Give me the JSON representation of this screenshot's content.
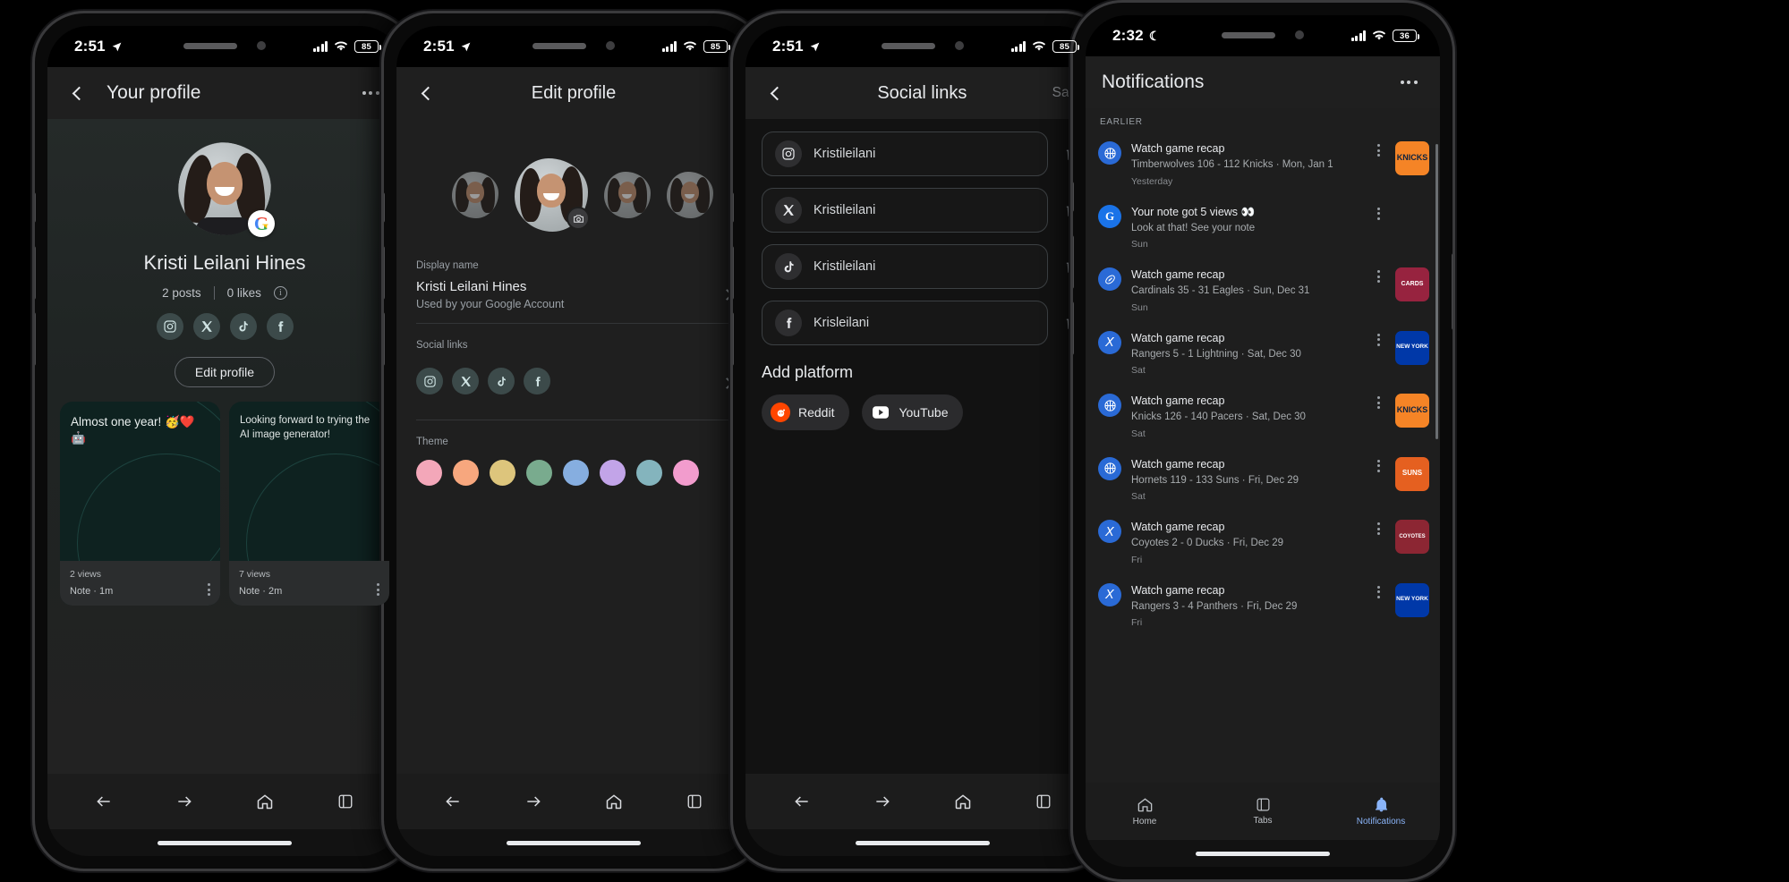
{
  "phones": {
    "profile": {
      "status": {
        "time": "2:51",
        "location_icon": "location-arrow",
        "battery": "85"
      },
      "appbar": {
        "title": "Your profile",
        "back_icon": "chevron-left-icon",
        "overflow_icon": "more-icon"
      },
      "avatar": {
        "badge": "G"
      },
      "name": "Kristi Leilani Hines",
      "stats": {
        "posts": "2 posts",
        "likes": "0 likes",
        "info_icon": "info-icon"
      },
      "socials": [
        "instagram-icon",
        "x-icon",
        "tiktok-icon",
        "facebook-icon"
      ],
      "edit_button": "Edit profile",
      "notes": [
        {
          "text": "Almost one year! 🥳❤️🤖",
          "views": "2 views",
          "meta": "Note · 1m"
        },
        {
          "text": "Looking forward to trying the AI image generator!",
          "views": "7 views",
          "meta": "Note · 2m"
        }
      ],
      "nav": [
        "back-icon",
        "forward-icon",
        "home-icon",
        "tabs-icon"
      ]
    },
    "edit": {
      "status": {
        "time": "2:51",
        "battery": "85"
      },
      "appbar": {
        "title": "Edit profile",
        "back_icon": "chevron-left-icon"
      },
      "camera_badge": "camera-icon",
      "display_name_label": "Display name",
      "display_name_value": "Kristi Leilani Hines",
      "display_name_sub": "Used by your Google Account",
      "social_links_label": "Social links",
      "socials": [
        "instagram-icon",
        "x-icon",
        "tiktok-icon",
        "facebook-icon"
      ],
      "theme_label": "Theme",
      "theme_colors": [
        "#f3a7b9",
        "#f7a77e",
        "#ddc57c",
        "#79ab8e",
        "#86aee0",
        "#c2a4e8",
        "#84b4bd",
        "#f29ccd"
      ],
      "nav": [
        "back-icon",
        "forward-icon",
        "home-icon",
        "tabs-icon"
      ]
    },
    "social": {
      "status": {
        "time": "2:51",
        "battery": "85"
      },
      "appbar": {
        "title": "Social links",
        "back_icon": "chevron-left-icon",
        "save_label": "Save"
      },
      "fields": [
        {
          "platform": "instagram-icon",
          "value": "Kristileilani",
          "delete_icon": "trash-icon"
        },
        {
          "platform": "x-icon",
          "value": "Kristileilani",
          "delete_icon": "trash-icon"
        },
        {
          "platform": "tiktok-icon",
          "value": "Kristileilani",
          "delete_icon": "trash-icon"
        },
        {
          "platform": "facebook-icon",
          "value": "Krisleilani",
          "delete_icon": "trash-icon"
        }
      ],
      "add_platform_title": "Add platform",
      "chips": [
        {
          "label": "Reddit",
          "icon": "reddit-icon",
          "color": "#ff4500"
        },
        {
          "label": "YouTube",
          "icon": "youtube-icon",
          "color": "#ff0000"
        }
      ],
      "nav": [
        "back-icon",
        "forward-icon",
        "home-icon",
        "tabs-icon"
      ]
    },
    "notifications": {
      "status": {
        "time": "2:32",
        "moon_icon": "crescent-moon",
        "battery": "36"
      },
      "appbar": {
        "title": "Notifications",
        "overflow_icon": "more-icon"
      },
      "section_label": "EARLIER",
      "items": [
        {
          "title": "Watch game recap",
          "desc": "Timberwolves 106 - 112 Knicks · Mon, Jan 1",
          "time": "Yesterday",
          "source_icon": "basketball-icon",
          "source_color": "#2a6ad6",
          "thumb": "KNICKS",
          "thumb_color": "#f58426"
        },
        {
          "title": "Your note got 5 views 👀",
          "desc": "Look at that! See your note",
          "time": "Sun",
          "source_icon": "G",
          "source_color": "#1a73e8",
          "thumb": "",
          "thumb_color": "transparent"
        },
        {
          "title": "Watch game recap",
          "desc": "Cardinals 35 - 31 Eagles · Sun, Dec 31",
          "time": "Sun",
          "source_icon": "football-icon",
          "source_color": "#2a6ad6",
          "thumb": "CARDS",
          "thumb_color": "#97233f"
        },
        {
          "title": "Watch game recap",
          "desc": "Rangers 5 - 1 Lightning · Sat, Dec 30",
          "time": "Sat",
          "source_icon": "hockey-icon",
          "source_color": "#2a6ad6",
          "thumb": "NEW YORK",
          "thumb_color": "#0038a8"
        },
        {
          "title": "Watch game recap",
          "desc": "Knicks 126 - 140 Pacers · Sat, Dec 30",
          "time": "Sat",
          "source_icon": "basketball-icon",
          "source_color": "#2a6ad6",
          "thumb": "KNICKS",
          "thumb_color": "#f58426"
        },
        {
          "title": "Watch game recap",
          "desc": "Hornets 119 - 133 Suns · Fri, Dec 29",
          "time": "Sat",
          "source_icon": "basketball-icon",
          "source_color": "#2a6ad6",
          "thumb": "SUNS",
          "thumb_color": "#e56020"
        },
        {
          "title": "Watch game recap",
          "desc": "Coyotes 2 - 0 Ducks · Fri, Dec 29",
          "time": "Fri",
          "source_icon": "hockey-icon",
          "source_color": "#2a6ad6",
          "thumb": "COYOTES",
          "thumb_color": "#8c2633"
        },
        {
          "title": "Watch game recap",
          "desc": "Rangers 3 - 4 Panthers · Fri, Dec 29",
          "time": "Fri",
          "source_icon": "hockey-icon",
          "source_color": "#2a6ad6",
          "thumb": "NEW YORK",
          "thumb_color": "#0038a8"
        }
      ],
      "tabs": [
        {
          "label": "Home",
          "icon": "home-icon",
          "active": false
        },
        {
          "label": "Tabs",
          "icon": "tabs-icon",
          "active": false
        },
        {
          "label": "Notifications",
          "icon": "bell-icon",
          "active": true
        }
      ]
    }
  }
}
